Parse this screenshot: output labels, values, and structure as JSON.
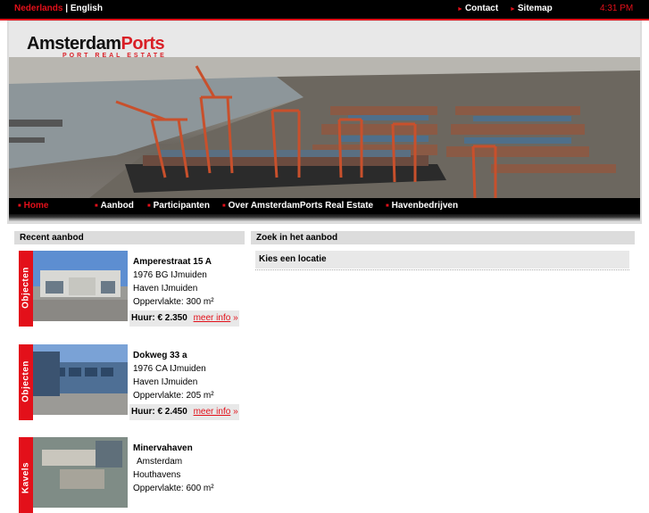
{
  "topbar": {
    "lang_nl": "Nederlands",
    "lang_sep": "|",
    "lang_en": "English",
    "contact": "Contact",
    "sitemap": "Sitemap",
    "time": "4:31 PM"
  },
  "logo": {
    "part1": "Amsterdam",
    "part2": "Ports",
    "tagline": "PORT REAL ESTATE"
  },
  "nav": [
    {
      "label": "Home"
    },
    {
      "label": "Aanbod"
    },
    {
      "label": "Participanten"
    },
    {
      "label": "Over AmsterdamPorts Real Estate"
    },
    {
      "label": "Havenbedrijven"
    }
  ],
  "recent": {
    "title": "Recent aanbod",
    "items": [
      {
        "tab": "Objecten",
        "title": "Amperestraat 15 A",
        "line1": "1976 BG IJmuiden",
        "line2": "Haven IJmuiden",
        "line3": "Oppervlakte: 300 m²",
        "price": "Huur: € 2.350",
        "more": "meer info",
        "more_arrow": "»"
      },
      {
        "tab": "Objecten",
        "title": "Dokweg 33 a",
        "line1": "1976 CA IJmuiden",
        "line2": "Haven IJmuiden",
        "line3": "Oppervlakte: 205 m²",
        "price": "Huur: € 2.450",
        "more": "meer info",
        "more_arrow": "»"
      },
      {
        "tab": "Kavels",
        "title": "Minervahaven",
        "line1": "Amsterdam",
        "line2": "Houthavens",
        "line3": "Oppervlakte: 600 m²"
      }
    ]
  },
  "search": {
    "title": "Zoek in het aanbod",
    "location_label": "Kies een locatie"
  },
  "colors": {
    "brand_red": "#e3101a",
    "nav_bg": "#000000",
    "panel_bg": "#dcdcdc"
  }
}
